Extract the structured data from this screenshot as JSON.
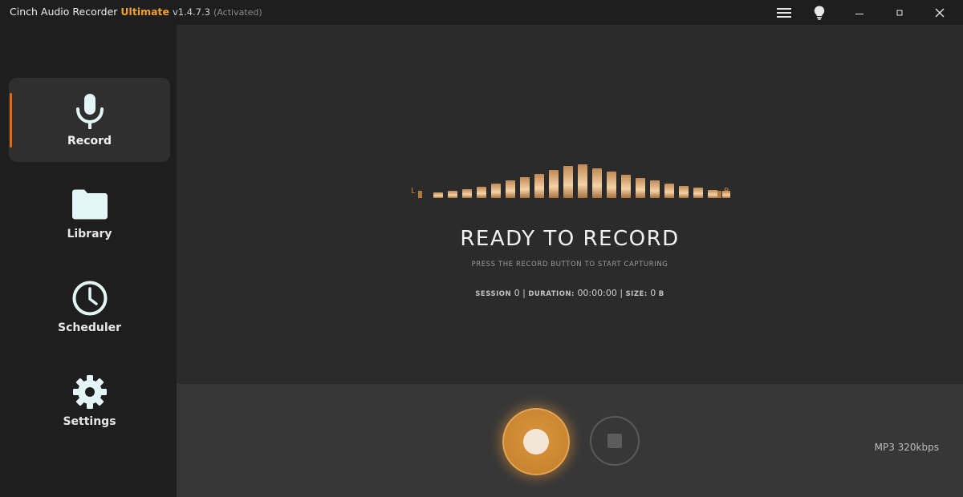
{
  "titlebar": {
    "app_name": "Cinch Audio Recorder",
    "edition": "Ultimate",
    "version": "v1.4.7.3",
    "status": "(Activated)",
    "icons": [
      "menu-icon",
      "lightbulb-icon",
      "minimize-icon",
      "maximize-icon",
      "close-icon"
    ]
  },
  "sidebar": {
    "items": [
      {
        "label": "Record",
        "icon": "microphone-icon",
        "active": true
      },
      {
        "label": "Library",
        "icon": "folder-icon",
        "active": false
      },
      {
        "label": "Scheduler",
        "icon": "clock-icon",
        "active": false
      },
      {
        "label": "Settings",
        "icon": "gear-icon",
        "active": false
      }
    ]
  },
  "main": {
    "meter": {
      "left_label": "L",
      "right_label": "R"
    },
    "status_title": "READY TO RECORD",
    "status_subtitle": "PRESS THE RECORD BUTTON TO START CAPTURING",
    "session": {
      "session_label": "SESSION",
      "session_value": "0",
      "duration_label": "DURATION:",
      "duration_value": "00:00:00",
      "size_label": "SIZE:",
      "size_value": "0",
      "size_unit": "B"
    }
  },
  "controls": {
    "record_button": "record",
    "stop_button": "stop",
    "format": "MP3 320kbps"
  },
  "colors": {
    "accent": "#e36a12",
    "edition": "#f0a030",
    "record": "#c9852f",
    "meter_gold": "#e0b07a"
  }
}
